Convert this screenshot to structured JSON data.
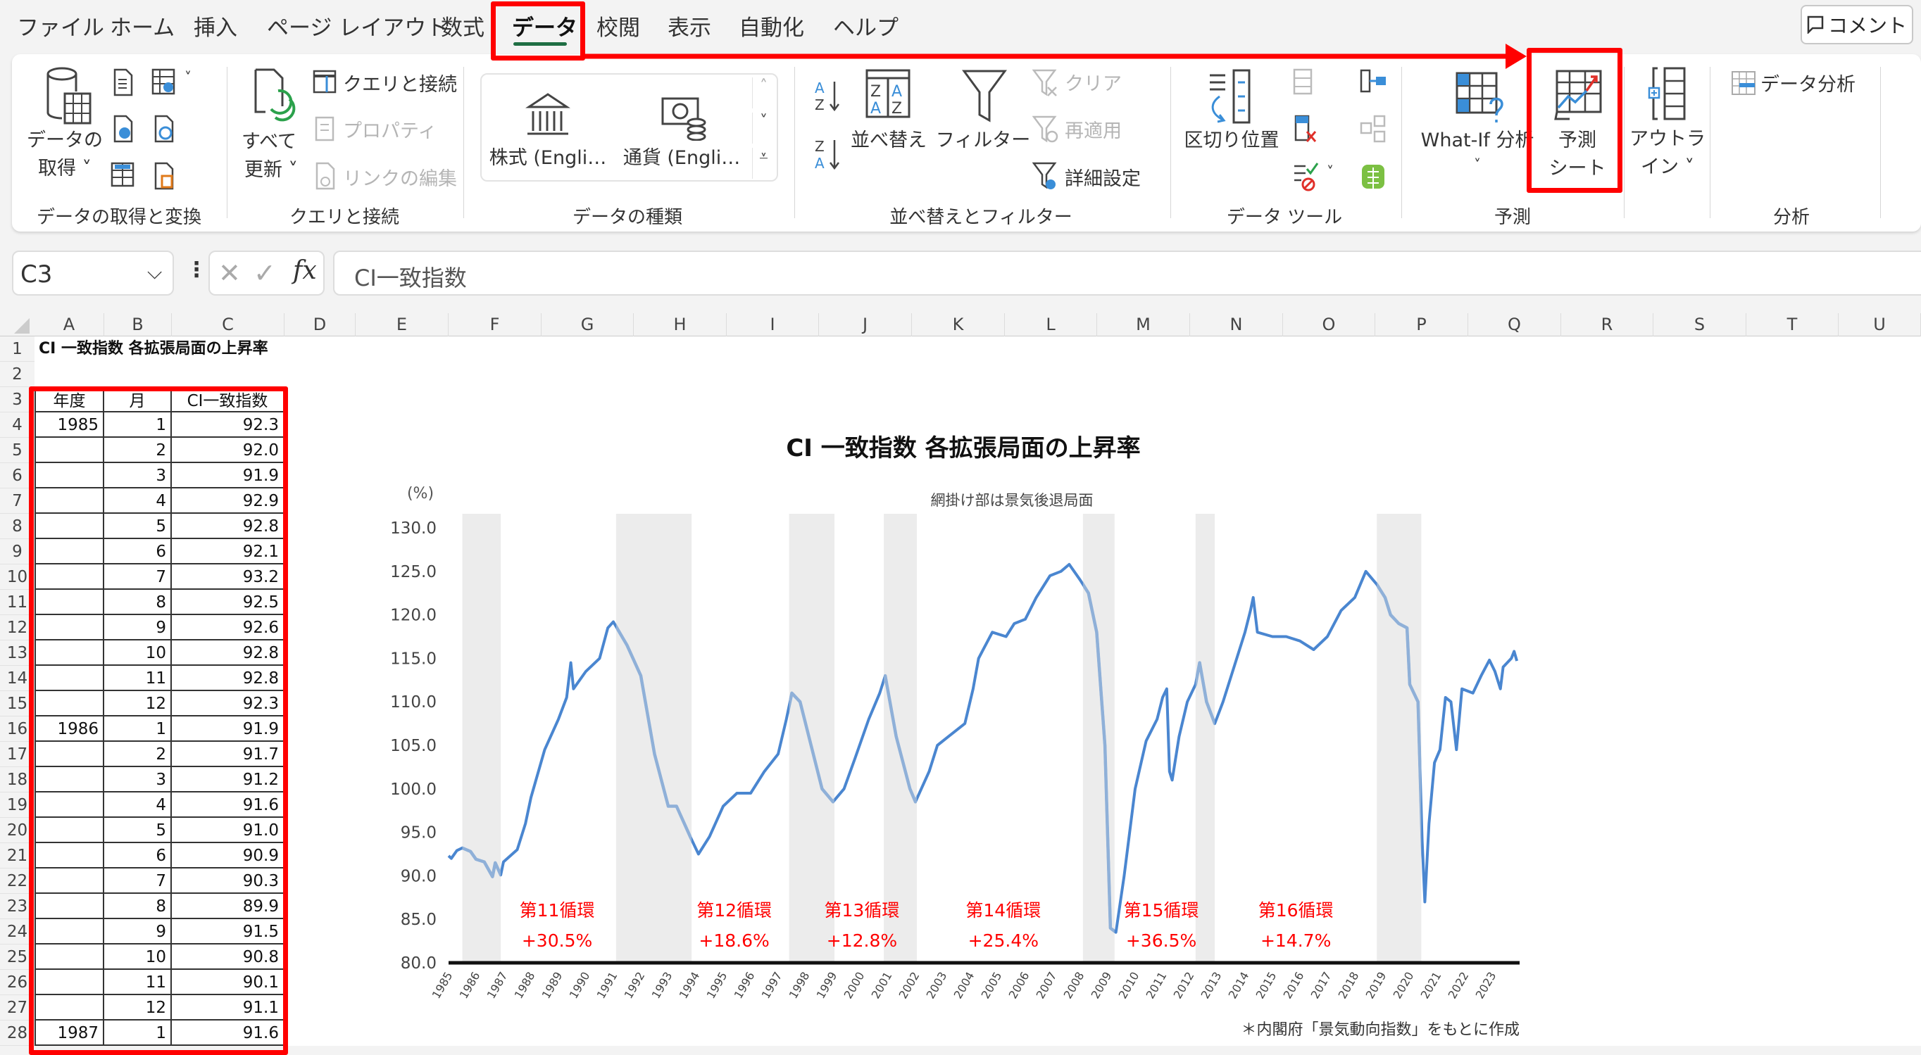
{
  "menu": {
    "tabs": [
      "ファイル",
      "ホーム",
      "挿入",
      "ページ レイアウト",
      "数式",
      "データ",
      "校閲",
      "表示",
      "自動化",
      "ヘルプ"
    ],
    "active_tab": "データ",
    "comment_button": "コメント"
  },
  "ribbon": {
    "groups": {
      "get_transform": {
        "label": "データの取得と変換",
        "get_data_line1": "データの",
        "get_data_line2": "取得 ˅"
      },
      "queries": {
        "label": "クエリと接続",
        "refresh_line1": "すべて",
        "refresh_line2": "更新 ˅",
        "queries_connections": "クエリと接続",
        "properties": "プロパティ",
        "edit_links": "リンクの編集"
      },
      "data_types": {
        "label": "データの種類",
        "stocks": "株式 (Engli…",
        "currencies": "通貨 (Engli…"
      },
      "sort_filter": {
        "label": "並べ替えとフィルター",
        "sort": "並べ替え",
        "filter": "フィルター",
        "clear": "クリア",
        "reapply": "再適用",
        "advanced": "詳細設定"
      },
      "data_tools": {
        "label": "データ ツール",
        "text_to_columns": "区切り位置"
      },
      "forecast": {
        "label": "予測",
        "what_if": "What-If 分析",
        "forecast_line1": "予測",
        "forecast_line2": "シート"
      },
      "outline": {
        "line1": "アウトラ",
        "line2": "イン ˅"
      },
      "analysis": {
        "label": "分析",
        "data_analysis": "データ分析"
      }
    }
  },
  "formula_bar": {
    "name_box": "C3",
    "formula": "CI一致指数",
    "fx": "fx"
  },
  "sheet": {
    "columns": [
      "A",
      "B",
      "C",
      "D",
      "E",
      "F",
      "G",
      "H",
      "I",
      "J",
      "K",
      "L",
      "M",
      "N",
      "O",
      "P",
      "Q",
      "R",
      "S",
      "T",
      "U"
    ],
    "row_numbers": [
      "1",
      "2",
      "3",
      "4",
      "5",
      "6",
      "7",
      "8",
      "9",
      "10",
      "11",
      "12",
      "13",
      "14",
      "15",
      "16",
      "17",
      "18",
      "19",
      "20",
      "21",
      "22",
      "23",
      "24",
      "25",
      "26",
      "27",
      "28"
    ],
    "title_cell": "CI 一致指数 各拡張局面の上昇率",
    "table_headers": [
      "年度",
      "月",
      "CI一致指数"
    ],
    "table_rows": [
      [
        "1985",
        "1",
        "92.3"
      ],
      [
        "",
        "2",
        "92.0"
      ],
      [
        "",
        "3",
        "91.9"
      ],
      [
        "",
        "4",
        "92.9"
      ],
      [
        "",
        "5",
        "92.8"
      ],
      [
        "",
        "6",
        "92.1"
      ],
      [
        "",
        "7",
        "93.2"
      ],
      [
        "",
        "8",
        "92.5"
      ],
      [
        "",
        "9",
        "92.6"
      ],
      [
        "",
        "10",
        "92.8"
      ],
      [
        "",
        "11",
        "92.8"
      ],
      [
        "",
        "12",
        "92.3"
      ],
      [
        "1986",
        "1",
        "91.9"
      ],
      [
        "",
        "2",
        "91.7"
      ],
      [
        "",
        "3",
        "91.2"
      ],
      [
        "",
        "4",
        "91.6"
      ],
      [
        "",
        "5",
        "91.0"
      ],
      [
        "",
        "6",
        "90.9"
      ],
      [
        "",
        "7",
        "90.3"
      ],
      [
        "",
        "8",
        "89.9"
      ],
      [
        "",
        "9",
        "91.5"
      ],
      [
        "",
        "10",
        "90.8"
      ],
      [
        "",
        "11",
        "90.1"
      ],
      [
        "",
        "12",
        "91.1"
      ],
      [
        "1987",
        "1",
        "91.6"
      ]
    ]
  },
  "annotation_color": "#ff0000",
  "chart_data": {
    "type": "line",
    "title": "CI 一致指数 各拡張局面の上昇率",
    "subtitle": "網掛け部は景気後退局面",
    "ylabel": "(%)",
    "footnote": "＊内閣府「景気動向指数」をもとに作成",
    "ylim": [
      80,
      130
    ],
    "yticks": [
      "80.0",
      "85.0",
      "90.0",
      "95.0",
      "100.0",
      "105.0",
      "110.0",
      "115.0",
      "120.0",
      "125.0",
      "130.0"
    ],
    "xticks": [
      "1985",
      "1986",
      "1987",
      "1988",
      "1989",
      "1990",
      "1991",
      "1992",
      "1993",
      "1994",
      "1995",
      "1996",
      "1997",
      "1998",
      "1999",
      "2000",
      "2001",
      "2002",
      "2003",
      "2004",
      "2005",
      "2006",
      "2007",
      "2008",
      "2009",
      "2010",
      "2011",
      "2012",
      "2013",
      "2014",
      "2015",
      "2016",
      "2017",
      "2018",
      "2019",
      "2020",
      "2021",
      "2022",
      "2023"
    ],
    "xlim": [
      1985,
      2024
    ],
    "line_color": "#4a86d0",
    "recession_line_color": "#8fb0d8",
    "recession_shade_color": "#ececec",
    "recessions": [
      [
        1985.5,
        1986.9
      ],
      [
        1991.1,
        1993.85
      ],
      [
        1997.4,
        1999.05
      ],
      [
        2000.85,
        2002.05
      ],
      [
        2008.1,
        2009.25
      ],
      [
        2012.2,
        2012.9
      ],
      [
        2018.8,
        2020.42
      ]
    ],
    "series_points": [
      [
        1985.0,
        92.3
      ],
      [
        1985.1,
        92.0
      ],
      [
        1985.3,
        92.9
      ],
      [
        1985.5,
        93.2
      ],
      [
        1985.8,
        92.8
      ],
      [
        1986.0,
        91.9
      ],
      [
        1986.3,
        91.6
      ],
      [
        1986.6,
        89.9
      ],
      [
        1986.7,
        91.5
      ],
      [
        1986.9,
        90.1
      ],
      [
        1987.0,
        91.6
      ],
      [
        1987.5,
        93
      ],
      [
        1987.8,
        96
      ],
      [
        1988.0,
        99
      ],
      [
        1988.5,
        104.5
      ],
      [
        1989.0,
        108
      ],
      [
        1989.3,
        110.5
      ],
      [
        1989.45,
        114.5
      ],
      [
        1989.55,
        111.5
      ],
      [
        1990.0,
        113.5
      ],
      [
        1990.5,
        115
      ],
      [
        1990.8,
        118.5
      ],
      [
        1991.0,
        119.2
      ],
      [
        1991.5,
        116.5
      ],
      [
        1992.0,
        113
      ],
      [
        1992.5,
        104
      ],
      [
        1993.0,
        98
      ],
      [
        1993.3,
        98
      ],
      [
        1993.8,
        94.5
      ],
      [
        1994.1,
        92.5
      ],
      [
        1994.5,
        94.5
      ],
      [
        1995.0,
        98
      ],
      [
        1995.5,
        99.5
      ],
      [
        1996.0,
        99.5
      ],
      [
        1996.5,
        102
      ],
      [
        1997.0,
        104
      ],
      [
        1997.3,
        108
      ],
      [
        1997.5,
        111
      ],
      [
        1997.8,
        110
      ],
      [
        1998.2,
        105
      ],
      [
        1998.6,
        100
      ],
      [
        1999.0,
        98.5
      ],
      [
        1999.4,
        100
      ],
      [
        1999.8,
        103.5
      ],
      [
        2000.3,
        108
      ],
      [
        2000.7,
        111
      ],
      [
        2000.9,
        113
      ],
      [
        2001.3,
        106
      ],
      [
        2001.8,
        100
      ],
      [
        2002.0,
        98.5
      ],
      [
        2002.5,
        102
      ],
      [
        2002.8,
        105
      ],
      [
        2003.2,
        106
      ],
      [
        2003.8,
        107.5
      ],
      [
        2004.1,
        111.5
      ],
      [
        2004.3,
        115
      ],
      [
        2004.8,
        118
      ],
      [
        2005.3,
        117.5
      ],
      [
        2005.6,
        119
      ],
      [
        2006.0,
        119.5
      ],
      [
        2006.4,
        122
      ],
      [
        2006.9,
        124.5
      ],
      [
        2007.3,
        125
      ],
      [
        2007.6,
        125.8
      ],
      [
        2008.0,
        124
      ],
      [
        2008.3,
        122.5
      ],
      [
        2008.6,
        118
      ],
      [
        2008.9,
        105
      ],
      [
        2009.1,
        84
      ],
      [
        2009.3,
        83.5
      ],
      [
        2009.6,
        90
      ],
      [
        2010.0,
        100
      ],
      [
        2010.4,
        105.5
      ],
      [
        2010.8,
        108
      ],
      [
        2011.0,
        110.5
      ],
      [
        2011.15,
        111.5
      ],
      [
        2011.25,
        102
      ],
      [
        2011.35,
        101
      ],
      [
        2011.6,
        106
      ],
      [
        2011.9,
        110
      ],
      [
        2012.2,
        112
      ],
      [
        2012.35,
        114.5
      ],
      [
        2012.6,
        110
      ],
      [
        2012.9,
        107.5
      ],
      [
        2013.2,
        110
      ],
      [
        2013.6,
        114
      ],
      [
        2014.0,
        118
      ],
      [
        2014.2,
        120.5
      ],
      [
        2014.3,
        122
      ],
      [
        2014.45,
        118
      ],
      [
        2015.0,
        117.5
      ],
      [
        2015.5,
        117.5
      ],
      [
        2016.0,
        117
      ],
      [
        2016.5,
        116
      ],
      [
        2017.0,
        117.5
      ],
      [
        2017.5,
        120.5
      ],
      [
        2018.0,
        122
      ],
      [
        2018.4,
        125
      ],
      [
        2018.8,
        123.5
      ],
      [
        2019.1,
        122
      ],
      [
        2019.3,
        120
      ],
      [
        2019.6,
        119
      ],
      [
        2019.9,
        118.5
      ],
      [
        2020.0,
        112
      ],
      [
        2020.3,
        110
      ],
      [
        2020.45,
        94
      ],
      [
        2020.55,
        87
      ],
      [
        2020.7,
        96
      ],
      [
        2020.9,
        103
      ],
      [
        2021.1,
        104.5
      ],
      [
        2021.3,
        110.5
      ],
      [
        2021.5,
        110
      ],
      [
        2021.7,
        104.5
      ],
      [
        2021.9,
        111.5
      ],
      [
        2022.3,
        111
      ],
      [
        2022.6,
        113
      ],
      [
        2022.9,
        114.8
      ],
      [
        2023.1,
        113.5
      ],
      [
        2023.3,
        111.5
      ],
      [
        2023.4,
        114
      ],
      [
        2023.7,
        115
      ],
      [
        2023.8,
        115.8
      ],
      [
        2023.9,
        114.7
      ]
    ],
    "annotations": [
      {
        "cycle": "第11循環",
        "rise": "+30.5%",
        "x": 1988.95
      },
      {
        "cycle": "第12循環",
        "rise": "+18.6%",
        "x": 1995.4
      },
      {
        "cycle": "第13循環",
        "rise": "+12.8%",
        "x": 2000.05
      },
      {
        "cycle": "第14循環",
        "rise": "+25.4%",
        "x": 2005.2
      },
      {
        "cycle": "第15循環",
        "rise": "+36.5%",
        "x": 2010.95
      },
      {
        "cycle": "第16循環",
        "rise": "+14.7%",
        "x": 2015.85
      }
    ],
    "annotation_color": "#ff0000",
    "grid": false
  }
}
